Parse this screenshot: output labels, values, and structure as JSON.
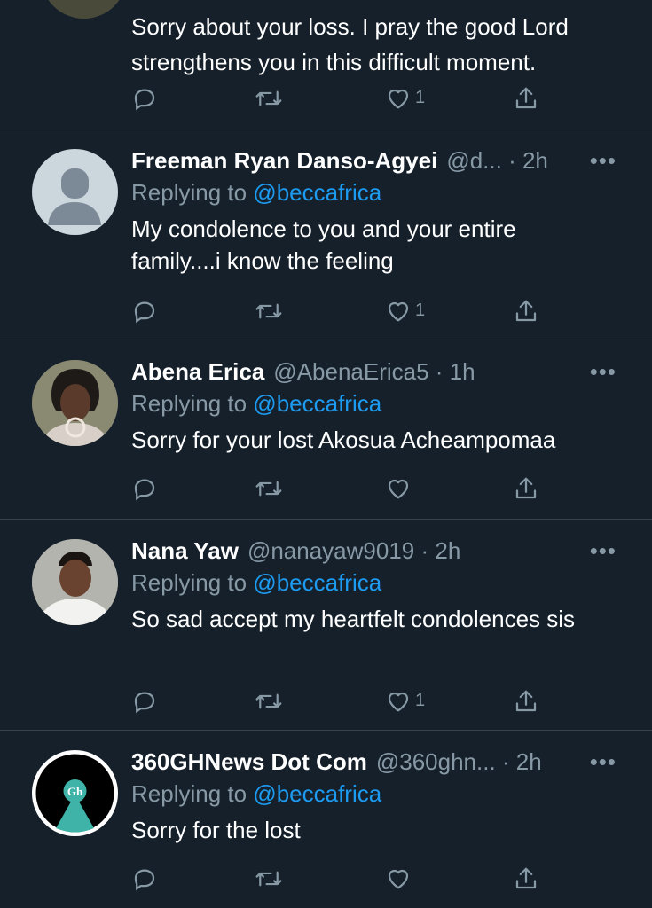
{
  "tweets": [
    {
      "name": "",
      "handle_time": "",
      "replying_prefix": "",
      "replying_handle": "",
      "text": "Sorry about your loss. I pray the good Lord strengthens you in this difficult moment.",
      "like_count": "1"
    },
    {
      "name": "Freeman Ryan Danso-Agyei",
      "handle_time": "@d... · 2h",
      "replying_prefix": "Replying to ",
      "replying_handle": "@beccafrica",
      "text": "My condolence to you and your entire family....i know the feeling",
      "like_count": "1"
    },
    {
      "name": "Abena Erica",
      "handle_time": "@AbenaErica5 · 1h",
      "replying_prefix": "Replying to ",
      "replying_handle": "@beccafrica",
      "text": "Sorry for your lost Akosua Acheampomaa",
      "like_count": ""
    },
    {
      "name": "Nana Yaw",
      "handle_time": "@nanayaw9019 · 2h",
      "replying_prefix": "Replying to ",
      "replying_handle": "@beccafrica",
      "text": "So sad accept my heartfelt condolences sis",
      "like_count": "1"
    },
    {
      "name": "360GHNews Dot Com",
      "handle_time": "@360ghn... · 2h",
      "replying_prefix": "Replying to ",
      "replying_handle": "@beccafrica",
      "text": "Sorry for the lost",
      "like_count": ""
    }
  ],
  "more_glyph": "•••",
  "logo_text": "Gh",
  "colors": {
    "background": "#15202b",
    "divider": "#38444d",
    "muted": "#8899a6",
    "link": "#1d9bf0"
  }
}
